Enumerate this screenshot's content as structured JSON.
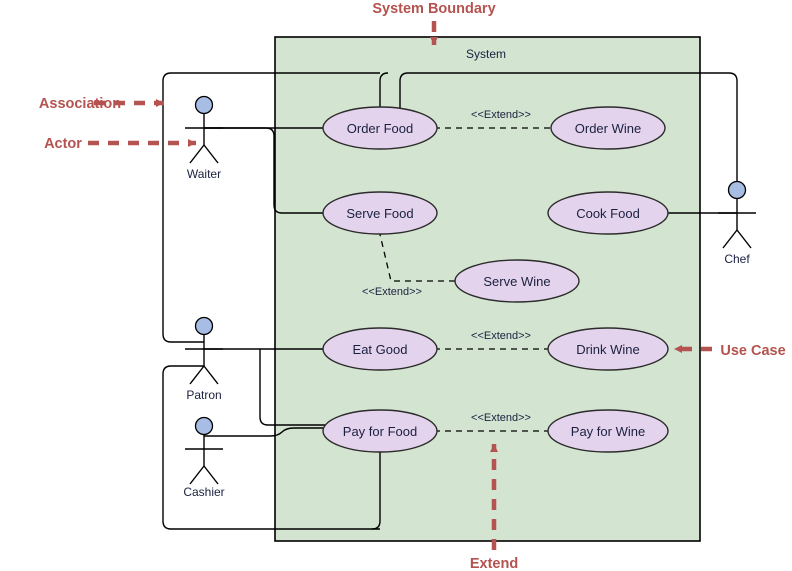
{
  "diagram": {
    "type": "uml-use-case-diagram",
    "system": {
      "label": "System",
      "fill_color": "#d3e5d0",
      "stroke_color": "#000000"
    },
    "use_case_style": {
      "fill_color": "#e4d3ec",
      "stroke_color": "#2b2b2b"
    },
    "actor_style": {
      "head_fill": "#a8bde4",
      "stroke_color": "#000000"
    },
    "annotation_color": "#b4534f"
  },
  "actors": [
    {
      "id": "waiter",
      "name": "Waiter"
    },
    {
      "id": "patron",
      "name": "Patron"
    },
    {
      "id": "cashier",
      "name": "Cashier"
    },
    {
      "id": "chef",
      "name": "Chef"
    }
  ],
  "use_cases": [
    {
      "id": "order_food",
      "name": "Order Food"
    },
    {
      "id": "order_wine",
      "name": "Order Wine"
    },
    {
      "id": "serve_food",
      "name": "Serve Food"
    },
    {
      "id": "cook_food",
      "name": "Cook Food"
    },
    {
      "id": "serve_wine",
      "name": "Serve Wine"
    },
    {
      "id": "eat_good",
      "name": "Eat Good"
    },
    {
      "id": "drink_wine",
      "name": "Drink Wine"
    },
    {
      "id": "pay_for_food",
      "name": "Pay for Food"
    },
    {
      "id": "pay_for_wine",
      "name": "Pay for Wine"
    }
  ],
  "extend_relations": [
    {
      "id": "ext_order",
      "label": "<<Extend>>",
      "from": "order_wine",
      "to": "order_food"
    },
    {
      "id": "ext_serve",
      "label": "<<Extend>>",
      "from": "serve_wine",
      "to": "serve_food"
    },
    {
      "id": "ext_eat",
      "label": "<<Extend>>",
      "from": "drink_wine",
      "to": "eat_good"
    },
    {
      "id": "ext_pay",
      "label": "<<Extend>>",
      "from": "pay_for_wine",
      "to": "pay_for_food"
    }
  ],
  "annotations": [
    {
      "id": "system_boundary",
      "label": "System Boundary",
      "position": "top"
    },
    {
      "id": "association",
      "label": "Association",
      "position": "left"
    },
    {
      "id": "actor",
      "label": "Actor",
      "position": "left"
    },
    {
      "id": "use_case",
      "label": "Use Case",
      "position": "right"
    },
    {
      "id": "extend",
      "label": "Extend",
      "position": "bottom"
    }
  ]
}
